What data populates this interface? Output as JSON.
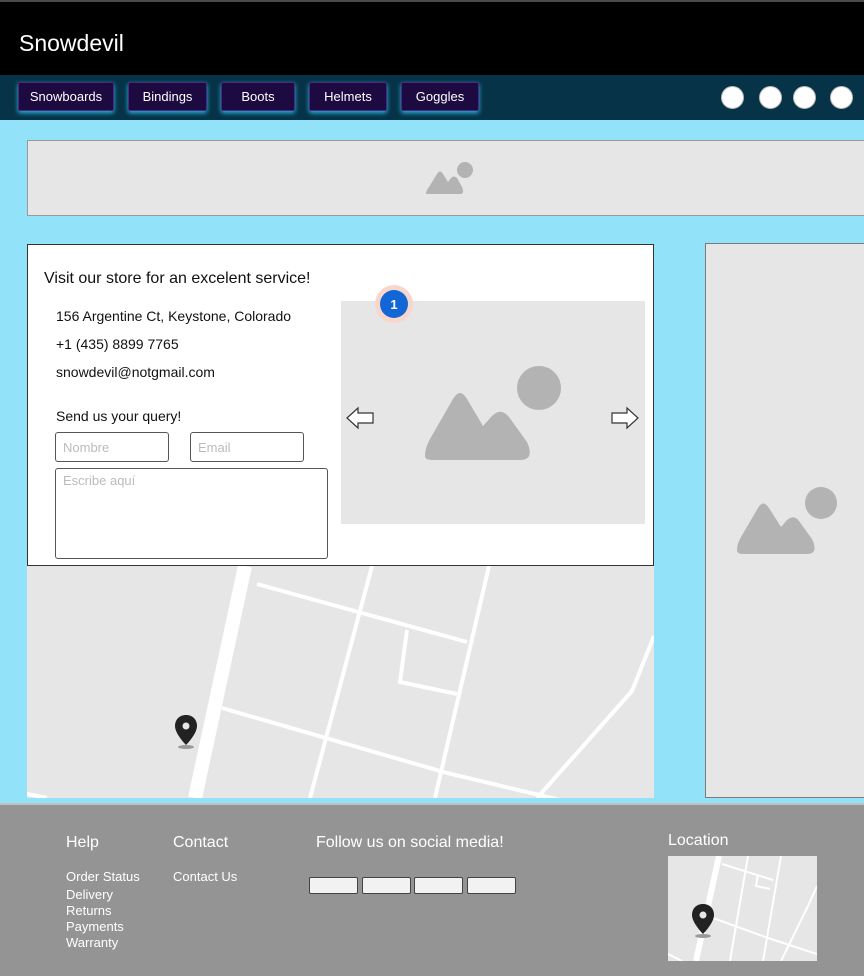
{
  "header": {
    "brand": "Snowdevil"
  },
  "nav": {
    "items": [
      {
        "label": "Snowboards"
      },
      {
        "label": "Bindings"
      },
      {
        "label": "Boots"
      },
      {
        "label": "Helmets"
      },
      {
        "label": "Goggles"
      }
    ]
  },
  "store": {
    "title": "Visit our store for an excelent service!",
    "address": "156 Argentine Ct, Keystone, Colorado",
    "phone": "+1 (435) 8899 7765",
    "email": "snowdevil@notgmail.com",
    "query_title": "Send us your query!",
    "name_placeholder": "Nombre",
    "email_placeholder": "Email",
    "message_placeholder": "Escribe aquí",
    "badge_count": "1"
  },
  "footer": {
    "help": {
      "title": "Help",
      "links": [
        {
          "label": "Order Status"
        },
        {
          "label": "Delivery"
        },
        {
          "label": "Returns"
        },
        {
          "label": "Payments"
        },
        {
          "label": "Warranty"
        }
      ]
    },
    "contact": {
      "title": "Contact",
      "link": "Contact Us"
    },
    "social": {
      "title": "Follow us on social media!"
    },
    "location": {
      "title": "Location"
    }
  },
  "colors": {
    "page_bg": "#92e3fa",
    "header_bg": "#000000",
    "nav_bg": "#063347",
    "nav_button_bg": "#1c0a40",
    "footer_bg": "#949494",
    "badge": "#1366d6"
  }
}
